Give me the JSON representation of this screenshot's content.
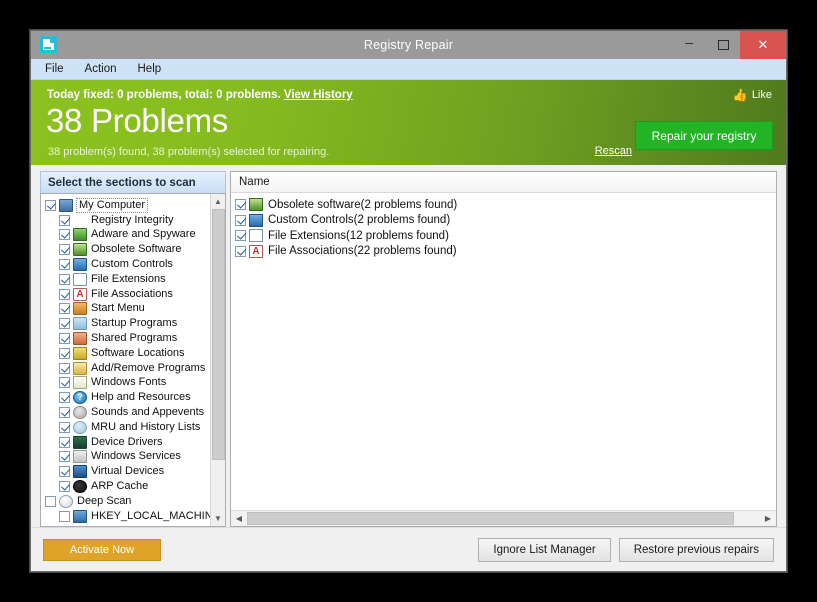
{
  "window": {
    "title": "Registry Repair",
    "app_icon": "registry-repair-icon",
    "buttons": {
      "minimize": "–",
      "maximize": "maximize-icon",
      "close": "✕"
    }
  },
  "menubar": {
    "items": [
      {
        "label": "File"
      },
      {
        "label": "Action"
      },
      {
        "label": "Help"
      }
    ]
  },
  "banner": {
    "today_text": "Today fixed: 0 problems, total: 0 problems.",
    "view_history": "View History",
    "headline": "38 Problems",
    "subtext": "38 problem(s) found, 38 problem(s) selected for repairing.",
    "like_label": "Like",
    "like_icon": "thumbs-up-icon",
    "rescan_label": "Rescan",
    "repair_label": "Repair your registry",
    "repair_color": "#22b424",
    "gradient_start": "#8cc21f",
    "gradient_end": "#507a1e"
  },
  "tree": {
    "header": "Select the sections to scan",
    "items": [
      {
        "label": "My Computer",
        "checked": true,
        "child": false,
        "selected": true,
        "icon": "ic-monitor"
      },
      {
        "label": "Registry Integrity",
        "checked": true,
        "child": true,
        "selected": false,
        "icon": "ic-blocks"
      },
      {
        "label": "Adware and Spyware",
        "checked": true,
        "child": true,
        "selected": false,
        "icon": "ic-green"
      },
      {
        "label": "Obsolete Software",
        "checked": true,
        "child": true,
        "selected": false,
        "icon": "ic-bin"
      },
      {
        "label": "Custom Controls",
        "checked": true,
        "child": true,
        "selected": false,
        "icon": "ic-custom"
      },
      {
        "label": "File Extensions",
        "checked": true,
        "child": true,
        "selected": false,
        "icon": "ic-fileext"
      },
      {
        "label": "File Associations",
        "checked": true,
        "child": true,
        "selected": false,
        "icon": "ic-assoc"
      },
      {
        "label": "Start Menu",
        "checked": true,
        "child": true,
        "selected": false,
        "icon": "ic-start"
      },
      {
        "label": "Startup Programs",
        "checked": true,
        "child": true,
        "selected": false,
        "icon": "ic-startup"
      },
      {
        "label": "Shared Programs",
        "checked": true,
        "child": true,
        "selected": false,
        "icon": "ic-shared"
      },
      {
        "label": "Software Locations",
        "checked": true,
        "child": true,
        "selected": false,
        "icon": "ic-softloc"
      },
      {
        "label": "Add/Remove Programs",
        "checked": true,
        "child": true,
        "selected": false,
        "icon": "ic-addrem"
      },
      {
        "label": "Windows Fonts",
        "checked": true,
        "child": true,
        "selected": false,
        "icon": "ic-fonts"
      },
      {
        "label": "Help and Resources",
        "checked": true,
        "child": true,
        "selected": false,
        "icon": "ic-help"
      },
      {
        "label": "Sounds and Appevents",
        "checked": true,
        "child": true,
        "selected": false,
        "icon": "ic-sound"
      },
      {
        "label": "MRU and History Lists",
        "checked": true,
        "child": true,
        "selected": false,
        "icon": "ic-mru"
      },
      {
        "label": "Device Drivers",
        "checked": true,
        "child": true,
        "selected": false,
        "icon": "ic-driver"
      },
      {
        "label": "Windows Services",
        "checked": true,
        "child": true,
        "selected": false,
        "icon": "ic-service"
      },
      {
        "label": "Virtual Devices",
        "checked": true,
        "child": true,
        "selected": false,
        "icon": "ic-virtual"
      },
      {
        "label": "ARP Cache",
        "checked": true,
        "child": true,
        "selected": false,
        "icon": "ic-arp"
      },
      {
        "label": "Deep Scan",
        "checked": false,
        "child": false,
        "selected": false,
        "icon": "ic-deep"
      },
      {
        "label": "HKEY_LOCAL_MACHINE",
        "checked": false,
        "child": true,
        "selected": false,
        "icon": "ic-hkey"
      }
    ]
  },
  "list": {
    "column_header": "Name",
    "rows": [
      {
        "label": "Obsolete software(2 problems found)",
        "checked": true,
        "icon": "ic-bin"
      },
      {
        "label": "Custom Controls(2 problems found)",
        "checked": true,
        "icon": "ic-custom"
      },
      {
        "label": "File Extensions(12 problems found)",
        "checked": true,
        "icon": "ic-fileext"
      },
      {
        "label": "File Associations(22 problems found)",
        "checked": true,
        "icon": "ic-assoc"
      }
    ]
  },
  "footer": {
    "activate_label": "Activate Now",
    "activate_color": "#e0a32a",
    "ignore_label": "Ignore List Manager",
    "restore_label": "Restore previous repairs"
  }
}
